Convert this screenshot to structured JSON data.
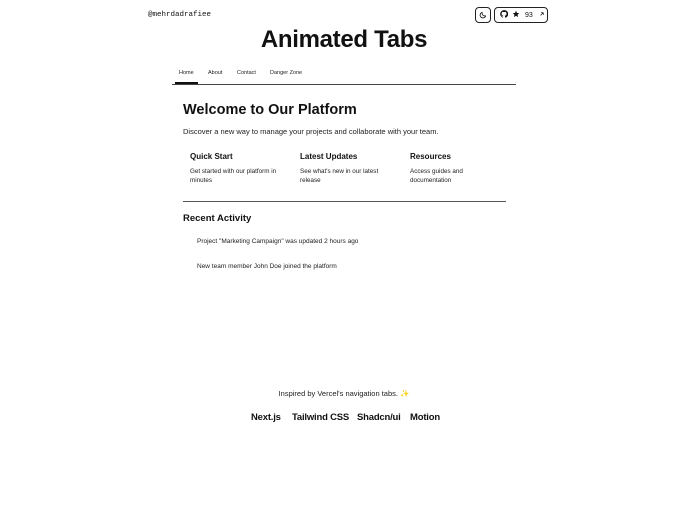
{
  "header": {
    "handle": "@mehrdadrafiee",
    "star_count": "93"
  },
  "title": "Animated Tabs",
  "tabs": [
    {
      "label": "Home",
      "active": true
    },
    {
      "label": "About",
      "active": false
    },
    {
      "label": "Contact",
      "active": false
    },
    {
      "label": "Danger Zone",
      "active": false
    }
  ],
  "content": {
    "heading": "Welcome to Our Platform",
    "intro": "Discover a new way to manage your projects and collaborate with your team.",
    "cards": [
      {
        "title": "Quick Start",
        "text": "Get started with our platform in minutes"
      },
      {
        "title": "Latest Updates",
        "text": "See what's new in our latest release"
      },
      {
        "title": "Resources",
        "text": "Access guides and documentation"
      }
    ],
    "recent_heading": "Recent Activity",
    "activity": [
      "Project \"Marketing Campaign\" was updated 2 hours ago",
      "New team member John Doe joined the platform"
    ]
  },
  "footer": {
    "inspired": "Inspired by Vercel's navigation tabs.",
    "tech": [
      "Next.js",
      "Tailwind CSS",
      "Shadcn/ui",
      "Motion"
    ]
  },
  "icons": {
    "theme": "moon-icon",
    "github": "github-icon",
    "star": "star-icon",
    "external": "arrow-up-right-icon",
    "spark": "sparkle-icon"
  }
}
